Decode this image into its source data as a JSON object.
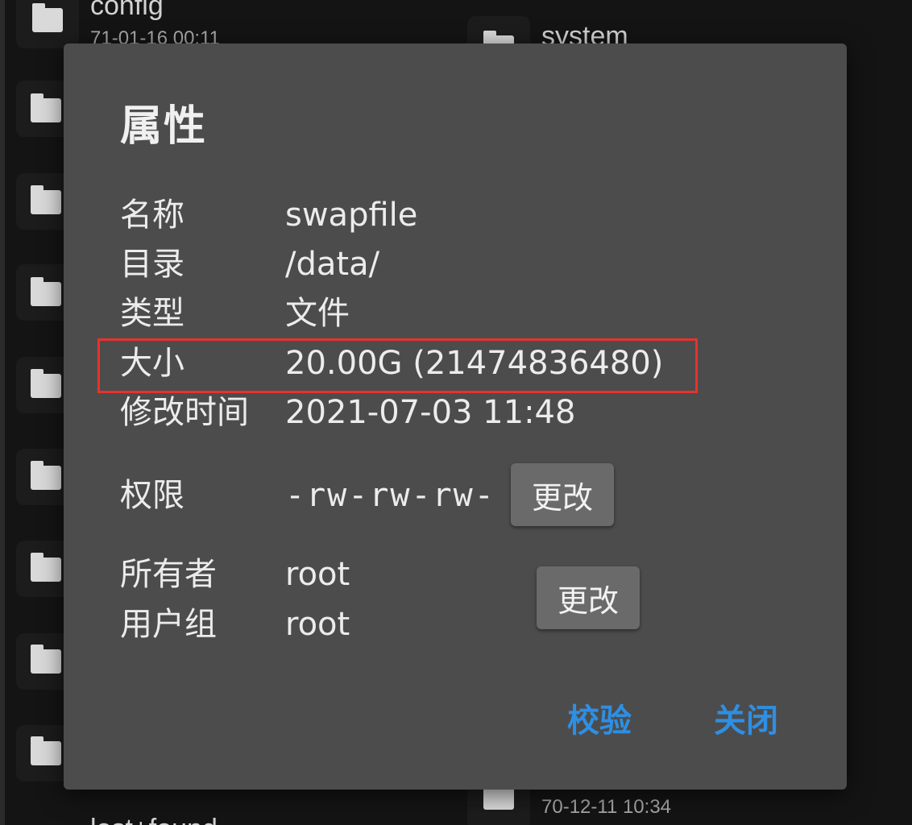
{
  "background": {
    "items": [
      {
        "name": "config",
        "date": "71-01-16 00:11"
      },
      {
        "name": "system",
        "date": ""
      },
      {
        "name": "",
        "date": "70-12-11 10:34"
      },
      {
        "name": "lost+found",
        "date": ""
      }
    ]
  },
  "dialog": {
    "title": "属性",
    "name_label": "名称",
    "name_value": "swapfile",
    "dir_label": "目录",
    "dir_value": "/data/",
    "type_label": "类型",
    "type_value": "文件",
    "size_label": "大小",
    "size_value": "20.00G (21474836480)",
    "mtime_label": "修改时间",
    "mtime_value": "2021-07-03 11:48",
    "perm_label": "权限",
    "perm_value": "-rw-rw-rw-",
    "perm_change_label": "更改",
    "owner_label": "所有者",
    "owner_value": "root",
    "group_label": "用户组",
    "group_value": "root",
    "owner_change_label": "更改",
    "verify_label": "校验",
    "close_label": "关闭"
  },
  "colors": {
    "dialog_bg": "#4c4c4c",
    "accent": "#2e8fe3",
    "highlight": "#e8322c"
  }
}
